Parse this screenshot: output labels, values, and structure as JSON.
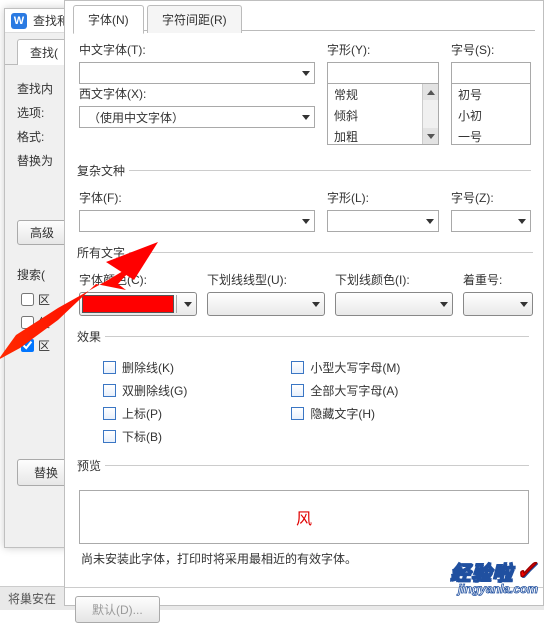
{
  "bg": {
    "title": "查找和",
    "tab": "查找(",
    "rows": {
      "find_label": "查找内",
      "options_label": "选项:",
      "format_label": "格式:",
      "replace_label": "替换为"
    },
    "advanced_btn": "高级",
    "search_label": "搜索(",
    "checks": {
      "chk1": "区",
      "chk2": "使",
      "chk3": "区"
    },
    "replace_btn": "替换"
  },
  "status_text": "将巢安在",
  "dlg": {
    "tabs": {
      "font": "字体(N)",
      "spacing": "字符间距(R)"
    },
    "cn_font_label": "中文字体(T):",
    "style_label": "字形(Y):",
    "size_label": "字号(S):",
    "styles": [
      "常规",
      "倾斜",
      "加粗"
    ],
    "sizes": [
      "初号",
      "小初",
      "一号"
    ],
    "latin_label": "西文字体(X):",
    "latin_value": "（使用中文字体）",
    "complex_legend": "复杂文种",
    "complex_font": "字体(F):",
    "complex_style": "字形(L):",
    "complex_size": "字号(Z):",
    "all_text_legend": "所有文字",
    "color_label": "字体颜色(C):",
    "underline_label": "下划线线型(U):",
    "underline_color_label": "下划线颜色(I):",
    "emphasis_label": "着重号:",
    "effects_legend": "效果",
    "effects_left": [
      "删除线(K)",
      "双删除线(G)",
      "上标(P)",
      "下标(B)"
    ],
    "effects_right": [
      "小型大写字母(M)",
      "全部大写字母(A)",
      "隐藏文字(H)"
    ],
    "preview_legend": "预览",
    "preview_text": "风",
    "note": "尚未安装此字体，打印时将采用最相近的有效字体。",
    "default_btn": "默认(D)..."
  },
  "watermark": {
    "top": "经验啦",
    "bottom": "jingyanla.com"
  }
}
